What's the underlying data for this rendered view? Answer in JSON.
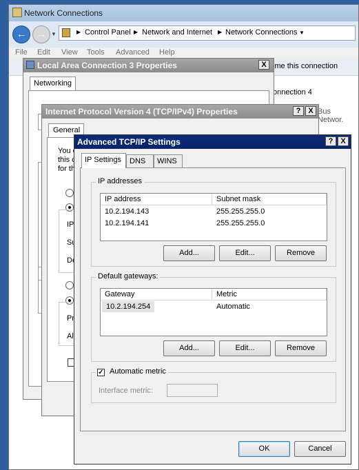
{
  "explorer": {
    "title": "Network Connections",
    "breadcrumb": [
      "Control Panel",
      "Network and Internet",
      "Network Connections"
    ],
    "menu": [
      "File",
      "Edit",
      "View",
      "Tools",
      "Advanced",
      "Help"
    ],
    "rename_text": "ename this connection",
    "conn_text": "onnection 4",
    "bus_text": "Bus Networ."
  },
  "lac": {
    "title": "Local Area Connection 3 Properties",
    "tab": "Networking"
  },
  "ipv4": {
    "title": "Internet Protocol Version 4 (TCP/IPv4) Properties",
    "tab": "General",
    "frag1": "You c",
    "frag2": "this c",
    "frag3": "for th",
    "frag_ip": "IP",
    "frag_su": "Su",
    "frag_de": "De",
    "frag_pr": "Pr",
    "frag_al": "Alt"
  },
  "adv": {
    "title": "Advanced TCP/IP Settings",
    "help_btn": "?",
    "close_btn": "X",
    "tabs": [
      "IP Settings",
      "DNS",
      "WINS"
    ],
    "ip_group": "IP addresses",
    "ip_columns": [
      "IP address",
      "Subnet mask"
    ],
    "ip_rows": [
      [
        "10.2.194.143",
        "255.255.255.0"
      ],
      [
        "10.2.194.141",
        "255.255.255.0"
      ]
    ],
    "gw_group": "Default gateways:",
    "gw_columns": [
      "Gateway",
      "Metric"
    ],
    "gw_rows": [
      [
        "10.2.194.254",
        "Automatic"
      ]
    ],
    "add": "Add...",
    "edit": "Edit...",
    "remove": "Remove",
    "auto_metric_label": "Automatic metric",
    "auto_metric_checked": true,
    "interface_metric_label": "Interface metric:",
    "interface_metric_value": "",
    "ok": "OK",
    "cancel": "Cancel"
  }
}
